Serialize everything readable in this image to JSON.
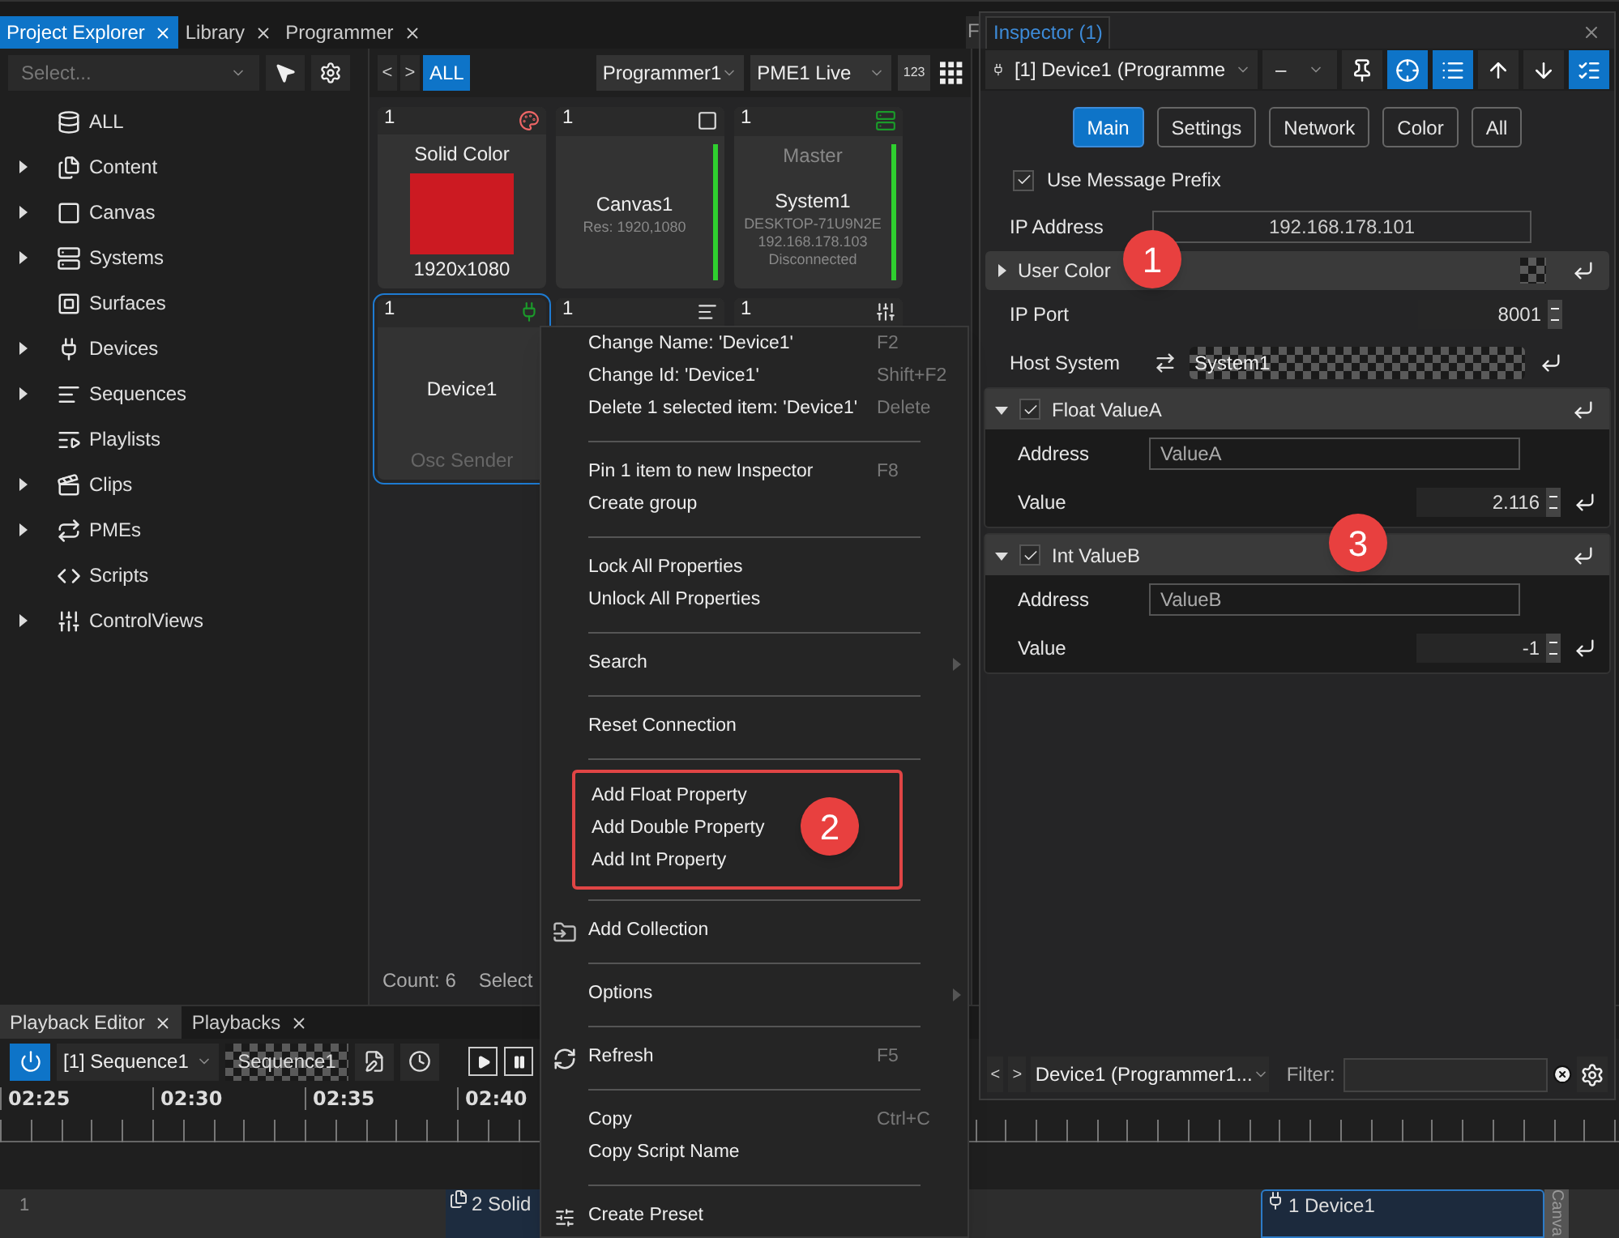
{
  "top_tabs": [
    {
      "label": "Project Explorer",
      "selected": true
    },
    {
      "label": "Library",
      "selected": false
    },
    {
      "label": "Programmer",
      "selected": false
    }
  ],
  "side_tab": {
    "label": "F"
  },
  "explorer": {
    "placeholder": "Select...",
    "items": [
      {
        "label": "ALL",
        "kind": "database",
        "expandable": false
      },
      {
        "label": "Content",
        "kind": "content",
        "expandable": true
      },
      {
        "label": "Canvas",
        "kind": "canvas",
        "expandable": true
      },
      {
        "label": "Systems",
        "kind": "system",
        "expandable": true
      },
      {
        "label": "Surfaces",
        "kind": "surface",
        "expandable": false
      },
      {
        "label": "Devices",
        "kind": "device",
        "expandable": true
      },
      {
        "label": "Sequences",
        "kind": "sequence",
        "expandable": true
      },
      {
        "label": "Playlists",
        "kind": "playlist",
        "expandable": false
      },
      {
        "label": "Clips",
        "kind": "clip",
        "expandable": true
      },
      {
        "label": "PMEs",
        "kind": "pme",
        "expandable": true
      },
      {
        "label": "Scripts",
        "kind": "script",
        "expandable": false
      },
      {
        "label": "ControlViews",
        "kind": "controlview",
        "expandable": true
      }
    ]
  },
  "programmer": {
    "nav": [
      "<",
      ">"
    ],
    "filter": {
      "label": "ALL",
      "selected": true
    },
    "programmer_select": "Programmer1",
    "pme_select": "PME1 Live",
    "number_button": "123",
    "tiles": [
      {
        "number": "1",
        "kind": "content",
        "heading": "Solid Color",
        "footer": "1920x1080",
        "active": false,
        "selected": false
      },
      {
        "number": "1",
        "kind": "canvas",
        "name": "Canvas1",
        "details": [
          "Res: 1920,1080"
        ],
        "active": true,
        "selected": false
      },
      {
        "number": "1",
        "kind": "system",
        "heading": "Master",
        "name": "System1",
        "details": [
          "DESKTOP-71U9N2E",
          "192.168.178.103",
          "Disconnected"
        ],
        "active": true,
        "selected": false
      },
      {
        "number": "1",
        "kind": "device",
        "name": "Device1",
        "footer": "Osc Sender",
        "active": false,
        "selected": true
      },
      {
        "number": "1",
        "kind": "sequence"
      },
      {
        "number": "1",
        "kind": "controlview"
      }
    ],
    "count": "Count: 6",
    "selected_text": "Select"
  },
  "playback": {
    "tabs": [
      {
        "label": "Playback Editor",
        "selected": true
      },
      {
        "label": "Playbacks",
        "selected": false
      }
    ],
    "power_on": true,
    "sequence_select": "[1] Sequence1",
    "sequence_label": "Sequence1",
    "times": [
      "02:25",
      "02:30",
      "02:35",
      "02:40"
    ],
    "track": {
      "label": "1",
      "clips": [
        {
          "kind": "content",
          "label": "2 Solid"
        },
        {
          "kind": "device",
          "label": "1 Device1"
        }
      ],
      "side_label": "Canva"
    }
  },
  "inspector": {
    "title": "Inspector (1)",
    "object_select": "[1] Device1 (Programme",
    "mode_select": "–",
    "tools": [
      {
        "kind": "pin",
        "active": false
      },
      {
        "kind": "target",
        "active": true
      },
      {
        "kind": "list",
        "active": true
      },
      {
        "kind": "up",
        "active": false
      },
      {
        "kind": "down",
        "active": false
      },
      {
        "kind": "checklist",
        "active": true
      }
    ],
    "tabs": [
      {
        "label": "Main",
        "selected": true
      },
      {
        "label": "Settings",
        "selected": false
      },
      {
        "label": "Network",
        "selected": false
      },
      {
        "label": "Color",
        "selected": false
      },
      {
        "label": "All",
        "selected": false
      }
    ],
    "properties": [
      {
        "kind": "checkbox",
        "label": "Use Message Prefix",
        "checked": true
      },
      {
        "kind": "text",
        "label": "IP Address",
        "value": "192.168.178.101"
      },
      {
        "kind": "group",
        "label": "User Color",
        "expanded": false
      },
      {
        "kind": "number",
        "label": "IP Port",
        "value": "8001"
      },
      {
        "kind": "link",
        "label": "Host System",
        "value": "System1"
      },
      {
        "kind": "section",
        "label": "Float ValueA",
        "expanded": true,
        "checked": true,
        "children": [
          {
            "kind": "field",
            "label": "Address",
            "value": "ValueA"
          },
          {
            "kind": "number",
            "label": "Value",
            "value": "2.116"
          }
        ]
      },
      {
        "kind": "section",
        "label": "Int ValueB",
        "expanded": true,
        "checked": true,
        "children": [
          {
            "kind": "field",
            "label": "Address",
            "value": "ValueB"
          },
          {
            "kind": "number",
            "label": "Value",
            "value": "-1"
          }
        ]
      }
    ],
    "footer": {
      "nav": [
        "<",
        ">"
      ],
      "select": "Device1 (Programmer1...",
      "filter_label": "Filter:"
    }
  },
  "context_menu": {
    "groups": [
      {
        "highlighted": false,
        "items": [
          {
            "label": "Change Name: 'Device1'",
            "shortcut": "F2"
          },
          {
            "label": "Change Id: 'Device1'",
            "shortcut": "Shift+F2"
          },
          {
            "label": "Delete 1 selected item: 'Device1'",
            "shortcut": "Delete"
          }
        ]
      },
      {
        "highlighted": false,
        "items": [
          {
            "label": "Pin 1 item to new Inspector",
            "shortcut": "F8"
          },
          {
            "label": "Create group"
          }
        ]
      },
      {
        "highlighted": false,
        "items": [
          {
            "label": "Lock All Properties"
          },
          {
            "label": "Unlock All Properties"
          }
        ]
      },
      {
        "highlighted": false,
        "items": [
          {
            "label": "Search",
            "submenu": true
          }
        ]
      },
      {
        "highlighted": false,
        "items": [
          {
            "label": "Reset Connection"
          }
        ]
      },
      {
        "highlighted": true,
        "items": [
          {
            "label": "Add Float Property"
          },
          {
            "label": "Add Double Property"
          },
          {
            "label": "Add Int Property"
          }
        ]
      },
      {
        "highlighted": false,
        "items": [
          {
            "label": "Add Collection",
            "kind": "folder"
          }
        ]
      },
      {
        "highlighted": false,
        "items": [
          {
            "label": "Options",
            "submenu": true
          }
        ]
      },
      {
        "highlighted": false,
        "items": [
          {
            "label": "Refresh",
            "shortcut": "F5",
            "kind": "refresh"
          }
        ]
      },
      {
        "highlighted": false,
        "items": [
          {
            "label": "Copy",
            "shortcut": "Ctrl+C"
          },
          {
            "label": "Copy Script Name"
          }
        ]
      },
      {
        "highlighted": false,
        "items": [
          {
            "label": "Create Preset",
            "kind": "preset"
          }
        ]
      }
    ]
  },
  "annotations": [
    "1",
    "2",
    "3"
  ]
}
